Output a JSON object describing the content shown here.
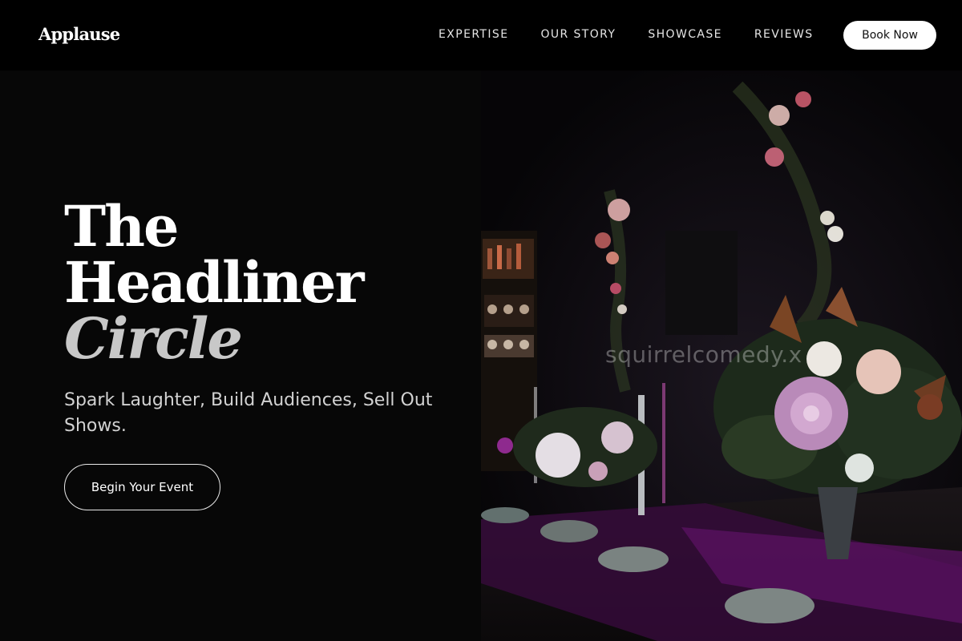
{
  "brand": {
    "name": "Applause"
  },
  "nav": {
    "links": [
      "EXPERTISE",
      "OUR STORY",
      "SHOWCASE",
      "REVIEWS"
    ],
    "book_label": "Book Now"
  },
  "hero": {
    "headline_line1": "The",
    "headline_line2": "Headliner",
    "headline_accent": "Circle",
    "tagline": "Spark Laughter, Build Audiences, Sell Out Shows.",
    "cta_label": "Begin Your Event",
    "image_watermark": "squirrelcomedy.x"
  },
  "colors": {
    "background": "#000000",
    "panel": "#070707",
    "accent_text": "#c8c8c8",
    "button_fill": "#ffffff"
  },
  "icons": {
    "hero_image": "floral-table-photo"
  }
}
